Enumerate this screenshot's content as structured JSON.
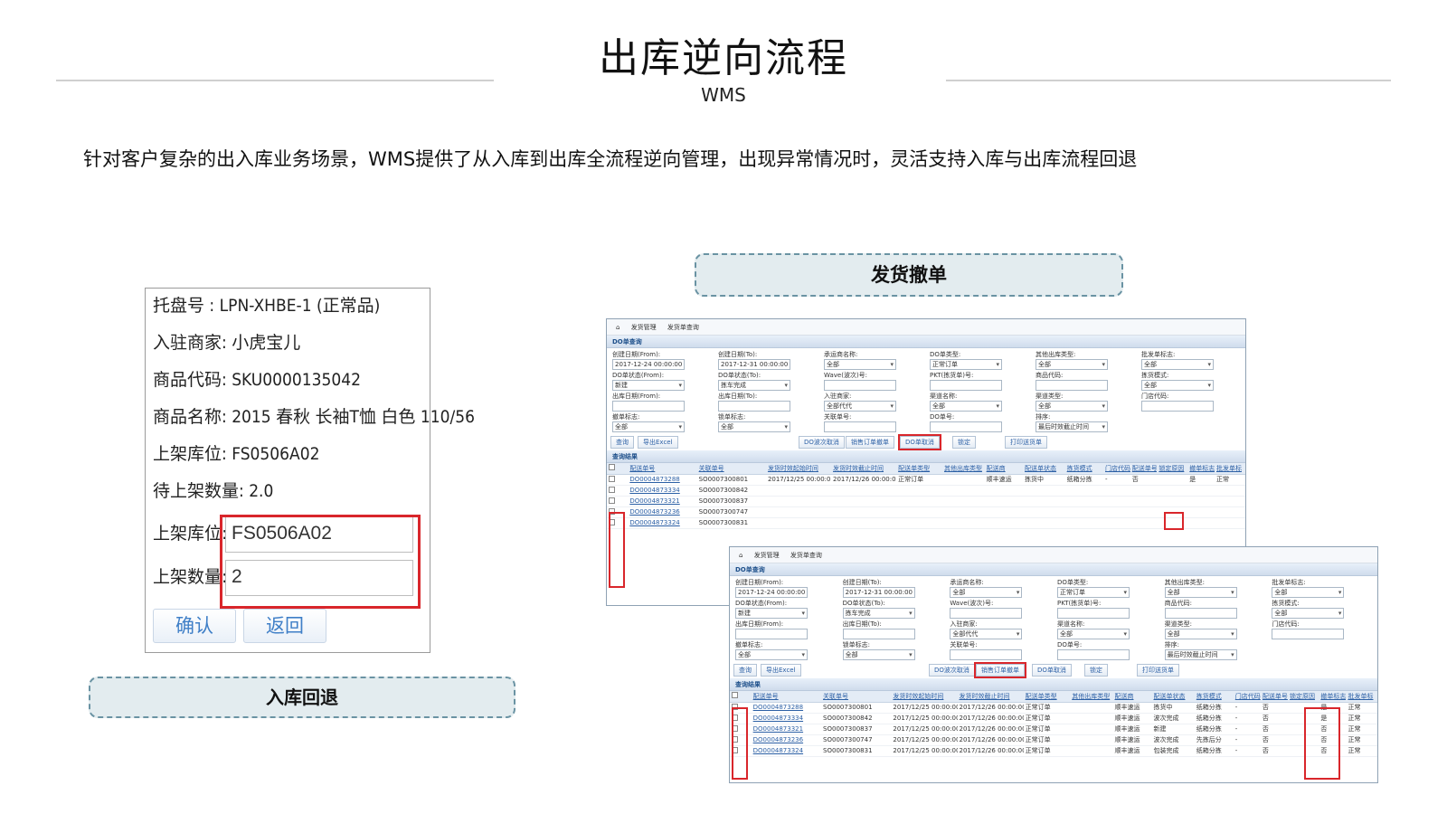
{
  "header": {
    "title": "出库逆向流程",
    "subtitle": "WMS",
    "description": "针对客户复杂的出入库业务场景，WMS提供了从入库到出库全流程逆向管理，出现异常情况时，灵活支持入库与出库流程回退"
  },
  "left_panel": {
    "caption": "入库回退",
    "lines": [
      "托盘号 : LPN-XHBE-1 (正常品)",
      "入驻商家: 小虎宝儿",
      "商品代码: SKU0000135042",
      "商品名称: 2015 春秋 长袖T恤 白色 110/56",
      "上架库位: FS0506A02",
      "待上架数量: 2.0"
    ],
    "fields": [
      {
        "label": "上架库位:",
        "value": "FS0506A02"
      },
      {
        "label": "上架数量:",
        "value": "2"
      }
    ],
    "buttons": {
      "confirm": "确认",
      "back": "返回"
    }
  },
  "right_panel": {
    "caption": "发货撤单",
    "breadcrumb": [
      "⌂",
      "发货管理",
      "发货单查询"
    ],
    "query_title": "DO单查询",
    "result_title": "查询结果",
    "filters": [
      {
        "label": "创建日期(From):",
        "value": "2017-12-24 00:00:00"
      },
      {
        "label": "创建日期(To):",
        "value": "2017-12-31 00:00:00"
      },
      {
        "label": "承运商名称:",
        "value": "全部"
      },
      {
        "label": "DO单类型:",
        "value": "正常订单"
      },
      {
        "label": "其他出库类型:",
        "value": "全部"
      },
      {
        "label": "批发单标志:",
        "value": "全部"
      },
      {
        "label": "DO单状态(From):",
        "value": "新建"
      },
      {
        "label": "DO单状态(To):",
        "value": "拣车完成"
      },
      {
        "label": "Wave(波次)号:",
        "value": ""
      },
      {
        "label": "PKT(拣货单)号:",
        "value": ""
      },
      {
        "label": "商品代码:",
        "value": ""
      },
      {
        "label": "拣货模式:",
        "value": "全部"
      },
      {
        "label": "出库日期(From):",
        "value": ""
      },
      {
        "label": "出库日期(To):",
        "value": ""
      },
      {
        "label": "入驻商家:",
        "value": "全部代代"
      },
      {
        "label": "渠道名称:",
        "value": "全部"
      },
      {
        "label": "渠道类型:",
        "value": "全部"
      },
      {
        "label": "门店代码:",
        "value": ""
      },
      {
        "label": "撤单标志:",
        "value": "全部"
      },
      {
        "label": "锁单标志:",
        "value": "全部"
      },
      {
        "label": "关联单号:",
        "value": ""
      },
      {
        "label": "DO单号:",
        "value": ""
      },
      {
        "label": "排序:",
        "value": "最后时效截止时间"
      },
      {
        "label": "",
        "value": ""
      }
    ],
    "buttons": [
      "查询",
      "导出Excel",
      "DO波次取消",
      "销售订单撤单",
      "DO单取消",
      "锁定",
      "打印送货单"
    ],
    "columns": [
      "配送单号",
      "关联单号",
      "发货时效起始时间",
      "发货时效截止时间",
      "配送单类型",
      "其他出库类型",
      "配送商",
      "配送单状态",
      "拣货模式",
      "门店代码",
      "配送单号",
      "锁定原因",
      "撤单标志",
      "批发单标"
    ],
    "rows_a": [
      [
        "DO0004873288",
        "SO0007300801",
        "2017/12/25 00:00:00",
        "2017/12/26 00:00:00",
        "正常订单",
        "",
        "顺丰速运",
        "拣货中",
        "纸箱分拣",
        "-",
        "否",
        "",
        "是",
        "正常"
      ],
      [
        "DO0004873334",
        "SO0007300842",
        "",
        "",
        "",
        "",
        "",
        "",
        "",
        "",
        "",
        "",
        "",
        ""
      ],
      [
        "DO0004873321",
        "SO0007300837",
        "",
        "",
        "",
        "",
        "",
        "",
        "",
        "",
        "",
        "",
        "",
        ""
      ],
      [
        "DO0004873236",
        "SO0007300747",
        "",
        "",
        "",
        "",
        "",
        "",
        "",
        "",
        "",
        "",
        "",
        ""
      ],
      [
        "DO0004873324",
        "SO0007300831",
        "",
        "",
        "",
        "",
        "",
        "",
        "",
        "",
        "",
        "",
        "",
        ""
      ]
    ],
    "rows_b": [
      [
        "DO0004873288",
        "SO0007300801",
        "2017/12/25 00:00:00",
        "2017/12/26 00:00:00",
        "正常订单",
        "",
        "顺丰速运",
        "拣货中",
        "纸箱分拣",
        "-",
        "否",
        "",
        "是",
        "正常"
      ],
      [
        "DO0004873334",
        "SO0007300842",
        "2017/12/25 00:00:00",
        "2017/12/26 00:00:00",
        "正常订单",
        "",
        "顺丰速运",
        "波次完成",
        "纸箱分拣",
        "-",
        "否",
        "",
        "是",
        "正常"
      ],
      [
        "DO0004873321",
        "SO0007300837",
        "2017/12/25 00:00:00",
        "2017/12/26 00:00:00",
        "正常订单",
        "",
        "顺丰速运",
        "新建",
        "纸箱分拣",
        "-",
        "否",
        "",
        "否",
        "正常"
      ],
      [
        "DO0004873236",
        "SO0007300747",
        "2017/12/25 00:00:00",
        "2017/12/26 00:00:00",
        "正常订单",
        "",
        "顺丰速运",
        "波次完成",
        "先拣后分",
        "-",
        "否",
        "",
        "否",
        "正常"
      ],
      [
        "DO0004873324",
        "SO0007300831",
        "2017/12/25 00:00:00",
        "2017/12/26 00:00:00",
        "正常订单",
        "",
        "顺丰速运",
        "包装完成",
        "纸箱分拣",
        "-",
        "否",
        "",
        "否",
        "正常"
      ]
    ]
  },
  "colors": {
    "highlight": "#d9262b",
    "caption_bg": "#e3ecef",
    "link": "#2b5fa5"
  }
}
